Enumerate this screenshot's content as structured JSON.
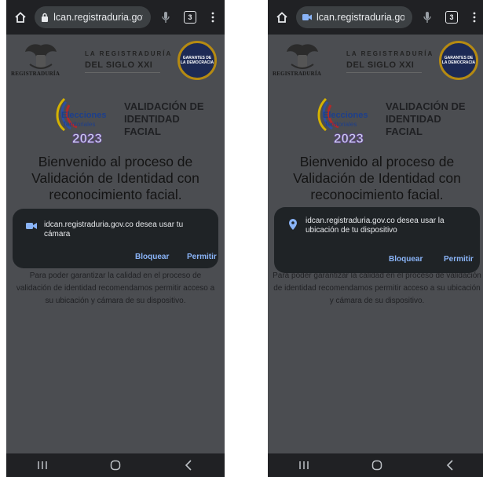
{
  "screens": [
    {
      "url": "lcan.registraduria.gov.co",
      "tab_count": "3",
      "url_icon": "lock-icon",
      "logo": {
        "registraduria": "REGISTRADURÍA",
        "siglo_line1": "LA REGISTRADURÍA",
        "siglo_line2": "DEL SIGLO XXI",
        "seal_text": "GARANTES DE LA DEMOCRACIA"
      },
      "elecciones": {
        "line1": "Elecciones",
        "line2": "Territoriales",
        "year": "2023"
      },
      "validation_title": "VALIDACIÓN DE IDENTIDAD FACIAL",
      "welcome": "Bienvenido al proceso de Validación de Identidad con reconocimiento facial.",
      "dialog": {
        "icon": "camera-icon",
        "message": "idcan.registraduria.gov.co desea usar tu cámara",
        "block": "Bloquear",
        "allow": "Permitir"
      },
      "paragraph": "Para poder garantizar la calidad en el proceso de validación de identidad recomendamos permitir acceso a su ubicación y cámara de su dispositivo."
    },
    {
      "url": "lcan.registraduria.gov.co",
      "tab_count": "3",
      "url_icon": "camera-tab-icon",
      "logo": {
        "registraduria": "REGISTRADURÍA",
        "siglo_line1": "LA REGISTRADURÍA",
        "siglo_line2": "DEL SIGLO XXI",
        "seal_text": "GARANTES DE LA DEMOCRACIA"
      },
      "elecciones": {
        "line1": "Elecciones",
        "line2": "Territoriales",
        "year": "2023"
      },
      "validation_title": "VALIDACIÓN DE IDENTIDAD FACIAL",
      "welcome": "Bienvenido al proceso de Validación de Identidad con reconocimiento facial.",
      "dialog": {
        "icon": "location-icon",
        "message": "idcan.registraduria.gov.co desea usar la ubicación de tu dispositivo",
        "block": "Bloquear",
        "allow": "Permitir"
      },
      "paragraph": "Para poder garantizar la calidad en el proceso de validación de identidad recomendamos permitir acceso a su ubicación y cámara de su dispositivo."
    }
  ],
  "colors": {
    "scrim": "#4b4d51",
    "bar": "#202124",
    "dialog": "#1f2326",
    "link": "#8ab4f8"
  }
}
